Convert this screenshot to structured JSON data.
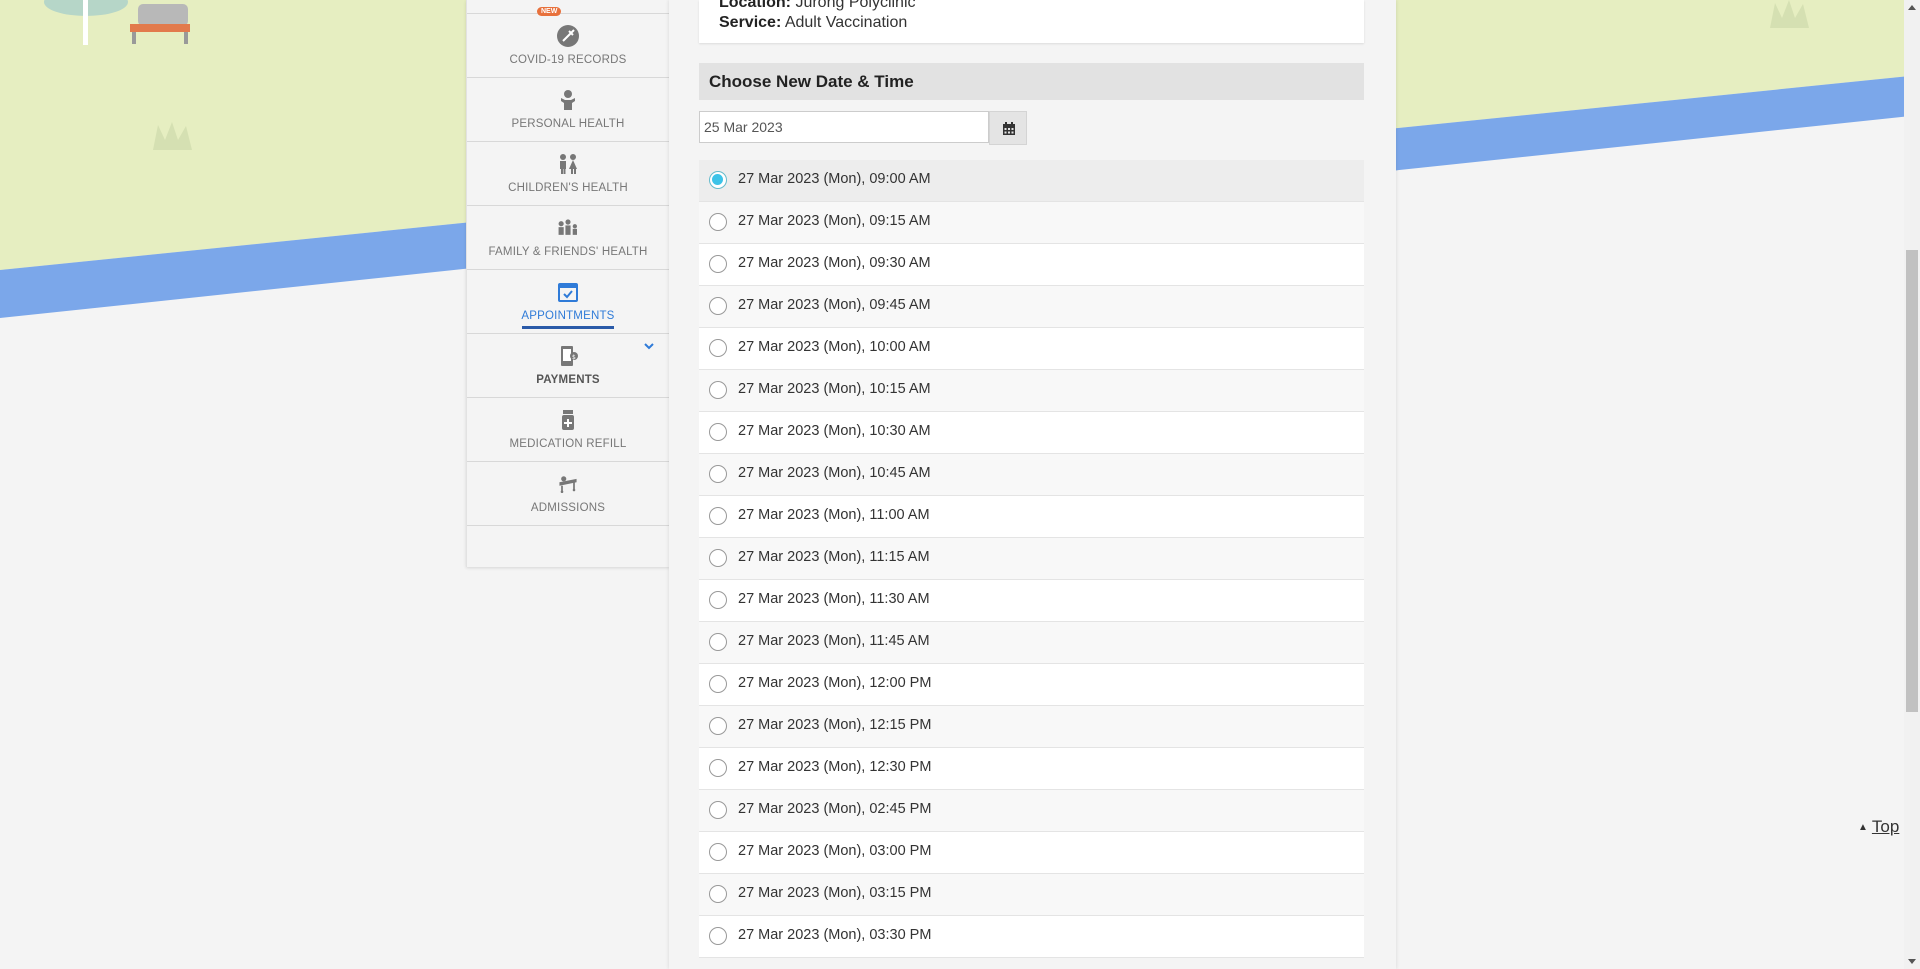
{
  "sidebar": {
    "items": [
      {
        "label": "COVID-19 RECORDS",
        "badge": "NEW"
      },
      {
        "label": "PERSONAL HEALTH"
      },
      {
        "label": "CHILDREN'S HEALTH"
      },
      {
        "label": "FAMILY & FRIENDS' HEALTH"
      },
      {
        "label": "APPOINTMENTS"
      },
      {
        "label": "PAYMENTS"
      },
      {
        "label": "MEDICATION REFILL"
      },
      {
        "label": "ADMISSIONS"
      }
    ]
  },
  "appointment": {
    "location_label": "Location:",
    "location_value": "Jurong Polyclinic",
    "service_label": "Service:",
    "service_value": "Adult Vaccination"
  },
  "section": {
    "title": "Choose New Date & Time"
  },
  "date_picker": {
    "value": "25 Mar 2023"
  },
  "slots": [
    "27 Mar 2023 (Mon), 09:00 AM",
    "27 Mar 2023 (Mon), 09:15 AM",
    "27 Mar 2023 (Mon), 09:30 AM",
    "27 Mar 2023 (Mon), 09:45 AM",
    "27 Mar 2023 (Mon), 10:00 AM",
    "27 Mar 2023 (Mon), 10:15 AM",
    "27 Mar 2023 (Mon), 10:30 AM",
    "27 Mar 2023 (Mon), 10:45 AM",
    "27 Mar 2023 (Mon), 11:00 AM",
    "27 Mar 2023 (Mon), 11:15 AM",
    "27 Mar 2023 (Mon), 11:30 AM",
    "27 Mar 2023 (Mon), 11:45 AM",
    "27 Mar 2023 (Mon), 12:00 PM",
    "27 Mar 2023 (Mon), 12:15 PM",
    "27 Mar 2023 (Mon), 12:30 PM",
    "27 Mar 2023 (Mon), 02:45 PM",
    "27 Mar 2023 (Mon), 03:00 PM",
    "27 Mar 2023 (Mon), 03:15 PM",
    "27 Mar 2023 (Mon), 03:30 PM"
  ],
  "selected_slot": "27 Mar 2023 (Mon), 09:00 AM",
  "top_link": {
    "label": "Top"
  },
  "colors": {
    "accent": "#2f7bd8",
    "radio_selected": "#3cc3e8",
    "river": "#7ba7ea",
    "grass": "#e6eec1"
  }
}
